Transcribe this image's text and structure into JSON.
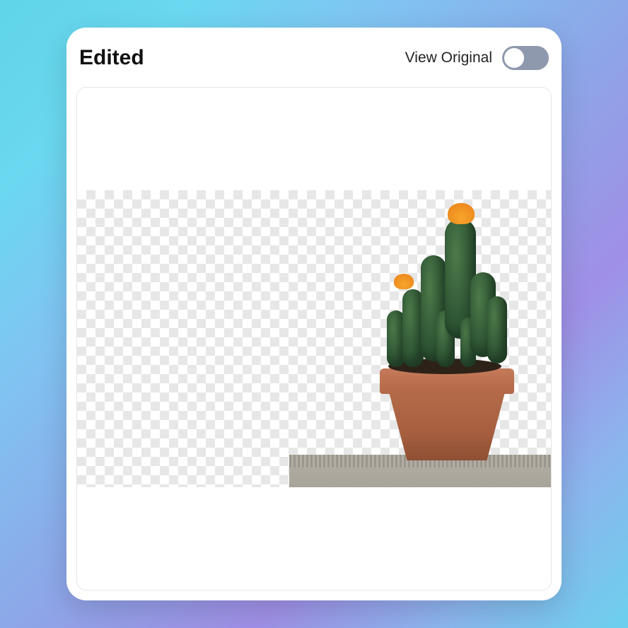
{
  "header": {
    "title": "Edited",
    "toggle_label": "View Original",
    "toggle_state": "off"
  },
  "image": {
    "subject": "potted-cactus-with-orange-flowers",
    "background": "transparent-checker"
  }
}
